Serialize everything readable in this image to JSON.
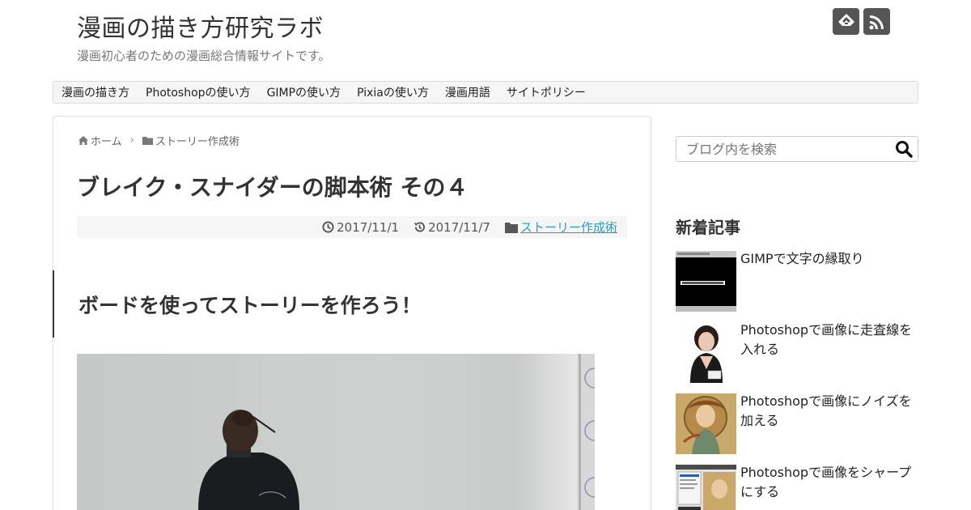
{
  "site": {
    "title": "漫画の描き方研究ラボ",
    "description": "漫画初心者のための漫画総合情報サイトです。"
  },
  "header_icons": [
    "feedly-icon",
    "rss-icon"
  ],
  "nav": {
    "items": [
      "漫画の描き方",
      "Photoshopの使い方",
      "GIMPの使い方",
      "Pixiaの使い方",
      "漫画用語",
      "サイトポリシー"
    ]
  },
  "breadcrumb": {
    "home": "ホーム",
    "category": "ストーリー作成術"
  },
  "post": {
    "title": "ブレイク・スナイダーの脚本術 その４",
    "published": "2017/11/1",
    "updated": "2017/11/7",
    "category": "ストーリー作成術",
    "heading": "ボードを使ってストーリーを作ろう！"
  },
  "sidebar": {
    "search_placeholder": "ブログ内を検索",
    "recent_title": "新着記事",
    "recent": [
      {
        "title": "GIMPで文字の縁取り"
      },
      {
        "title": "Photoshopで画像に走査線を入れる"
      },
      {
        "title": "Photoshopで画像にノイズを加える"
      },
      {
        "title": "Photoshopで画像をシャープにする"
      }
    ]
  },
  "colors": {
    "link": "#2a9fb5",
    "icon_bg": "#555555",
    "nav_bg": "#f5f5f5"
  }
}
